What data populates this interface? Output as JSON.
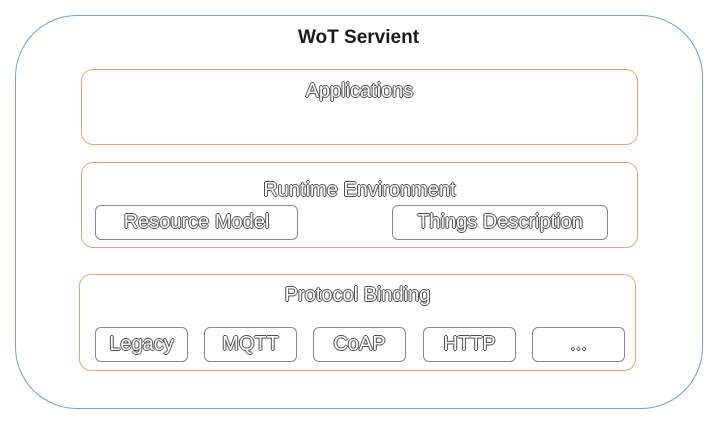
{
  "diagram": {
    "title": "WoT Servient",
    "layers": {
      "applications": {
        "label": "Applications"
      },
      "runtime": {
        "label": "Runtime Environment",
        "components": [
          "Resource Model",
          "Things Description"
        ]
      },
      "protocol": {
        "label": "Protocol Binding",
        "bindings": [
          "Legacy",
          "MQTT",
          "CoAP",
          "HTTP",
          "..."
        ]
      }
    },
    "colors": {
      "outer_border": "#6f9fd8",
      "layer_border": "#f0a070",
      "box_border": "#8a8a8a"
    }
  }
}
